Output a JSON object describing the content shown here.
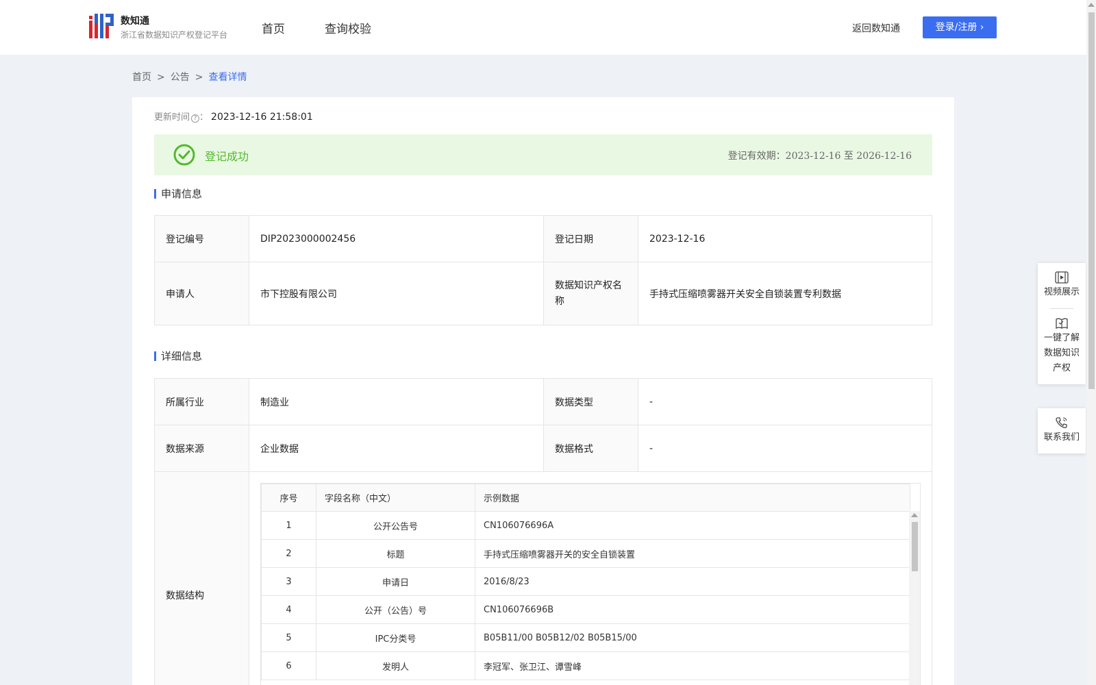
{
  "header": {
    "brand_name": "数知通",
    "brand_sub": "浙江省数据知识产权登记平台",
    "nav": [
      "首页",
      "查询校验"
    ],
    "back_link": "返回数知通",
    "login_label": "登录/注册",
    "login_chevron": "›"
  },
  "breadcrumb": {
    "items": [
      "首页",
      "公告",
      "查看详情"
    ],
    "separator": ">"
  },
  "update": {
    "label": "更新时间",
    "help_icon": "?",
    "colon": "：",
    "value": "2023-12-16 21:58:01"
  },
  "status": {
    "text": "登记成功",
    "validity_label": "登记有效期：",
    "validity_from": "2023-12-16",
    "validity_to_word": "至",
    "validity_to": "2026-12-16",
    "color": "#52b92c"
  },
  "apply_section": {
    "title": "申请信息",
    "rows": [
      {
        "l1": "登记编号",
        "v1": "DIP2023000002456",
        "l2": "登记日期",
        "v2": "2023-12-16"
      },
      {
        "l1": "申请人",
        "v1": "市下控股有限公司",
        "l2": "数据知识产权名称",
        "v2": "手持式压缩喷雾器开关安全自锁装置专利数据"
      }
    ]
  },
  "detail_section": {
    "title": "详细信息",
    "rows": [
      {
        "l1": "所属行业",
        "v1": "制造业",
        "l2": "数据类型",
        "v2": "-"
      },
      {
        "l1": "数据来源",
        "v1": "企业数据",
        "l2": "数据格式",
        "v2": "-"
      }
    ],
    "structure_label": "数据结构",
    "structure_headers": [
      "序号",
      "字段名称（中文）",
      "示例数据"
    ],
    "structure_rows": [
      {
        "no": "1",
        "name": "公开公告号",
        "sample": "CN106076696A"
      },
      {
        "no": "2",
        "name": "标题",
        "sample": "手持式压缩喷雾器开关的安全自锁装置"
      },
      {
        "no": "3",
        "name": "申请日",
        "sample": "2016/8/23"
      },
      {
        "no": "4",
        "name": "公开（公告）号",
        "sample": "CN106076696B"
      },
      {
        "no": "5",
        "name": "IPC分类号",
        "sample": "B05B11/00 B05B12/02 B05B15/00"
      },
      {
        "no": "6",
        "name": "发明人",
        "sample": "李冠军、张卫江、谭雪峰"
      }
    ]
  },
  "side_panel": {
    "items": [
      "视频展示",
      "一键了解数据知识产权"
    ],
    "contact": "联系我们"
  },
  "colors": {
    "accent": "#3a6df0",
    "success_bg": "#e9f8e3",
    "page_bg": "#eef1f5"
  }
}
